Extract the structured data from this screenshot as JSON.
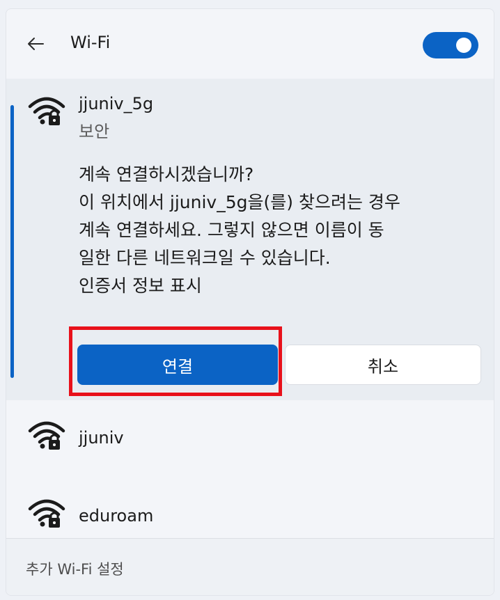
{
  "header": {
    "title": "Wi-Fi",
    "back_icon": "arrow-left-icon",
    "wifi_toggle": {
      "state": "on",
      "color": "#0b63c5"
    }
  },
  "selected_network": {
    "name": "jjuniv_5g",
    "status": "보안",
    "icon": "wifi-secured-icon",
    "message_lines": [
      "계속 연결하시겠습니까?",
      "이 위치에서 jjuniv_5g을(를) 찾으려는 경우",
      "계속 연결하세요. 그렇지 않으면 이름이 동",
      "일한 다른 네트워크일 수 있습니다."
    ],
    "cert_link": "인증서 정보 표시",
    "connect_label": "연결",
    "cancel_label": "취소"
  },
  "networks": [
    {
      "name": "jjuniv",
      "icon": "wifi-secured-icon"
    },
    {
      "name": "eduroam",
      "icon": "wifi-secured-icon"
    }
  ],
  "footer": {
    "more_settings": "추가 Wi-Fi 설정"
  },
  "colors": {
    "accent": "#0b63c5",
    "highlight_box": "#e8111b"
  }
}
